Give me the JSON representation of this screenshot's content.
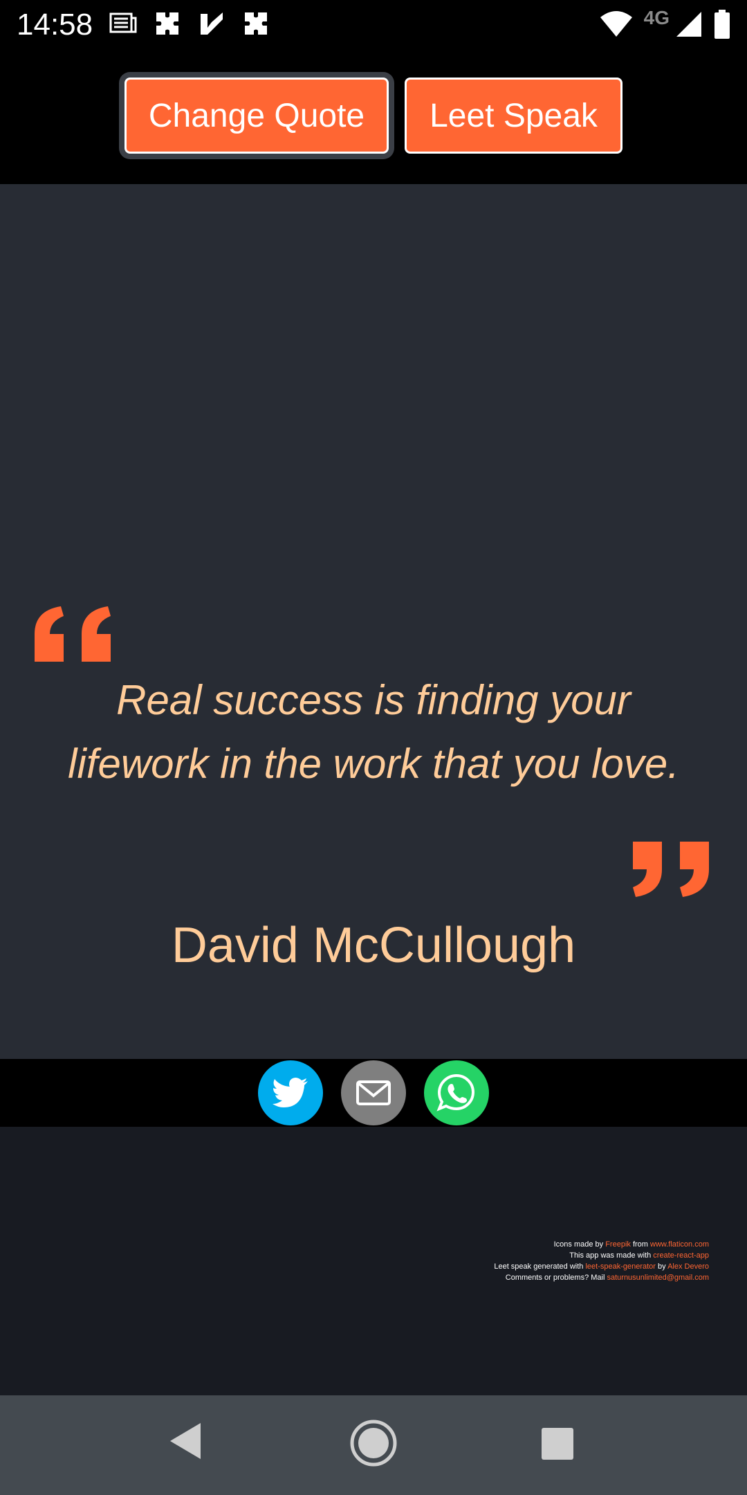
{
  "status_bar": {
    "time": "14:58",
    "network": "4G",
    "notification_icons": [
      "news-icon",
      "puzzle-icon",
      "check-app-icon",
      "puzzle-icon"
    ],
    "right_icons": [
      "wifi-icon",
      "signal-icon",
      "battery-icon"
    ]
  },
  "toolbar": {
    "change_quote_label": "Change Quote",
    "leet_speak_label": "Leet Speak"
  },
  "quote": {
    "text": "Real success is finding your lifework in the work that you love.",
    "author": "David McCullough"
  },
  "share": {
    "buttons": [
      "twitter-icon",
      "mail-icon",
      "whatsapp-icon"
    ]
  },
  "credits": {
    "line1_prefix": "Icons made by ",
    "line1_link1": "Freepik",
    "line1_mid": " from ",
    "line1_link2": "www.flaticon.com",
    "line2_prefix": "This app was made with ",
    "line2_link": "create-react-app",
    "line3_prefix": "Leet speak generated with ",
    "line3_link1": "leet-speak-generator",
    "line3_mid": " by ",
    "line3_link2": "Alex Devero",
    "line4_prefix": "Comments or problems? Mail ",
    "line4_link": "saturnusunlimited@gmail.com"
  },
  "colors": {
    "accent": "#ff6633",
    "quote_text": "#ffcc99",
    "quote_background": "#282c34",
    "footer_background": "#181b22",
    "twitter": "#00aced",
    "mail": "#7f7f7f",
    "whatsapp": "#25d366"
  },
  "nav_bar": {
    "buttons": [
      "back-icon",
      "home-icon",
      "recents-icon"
    ]
  }
}
